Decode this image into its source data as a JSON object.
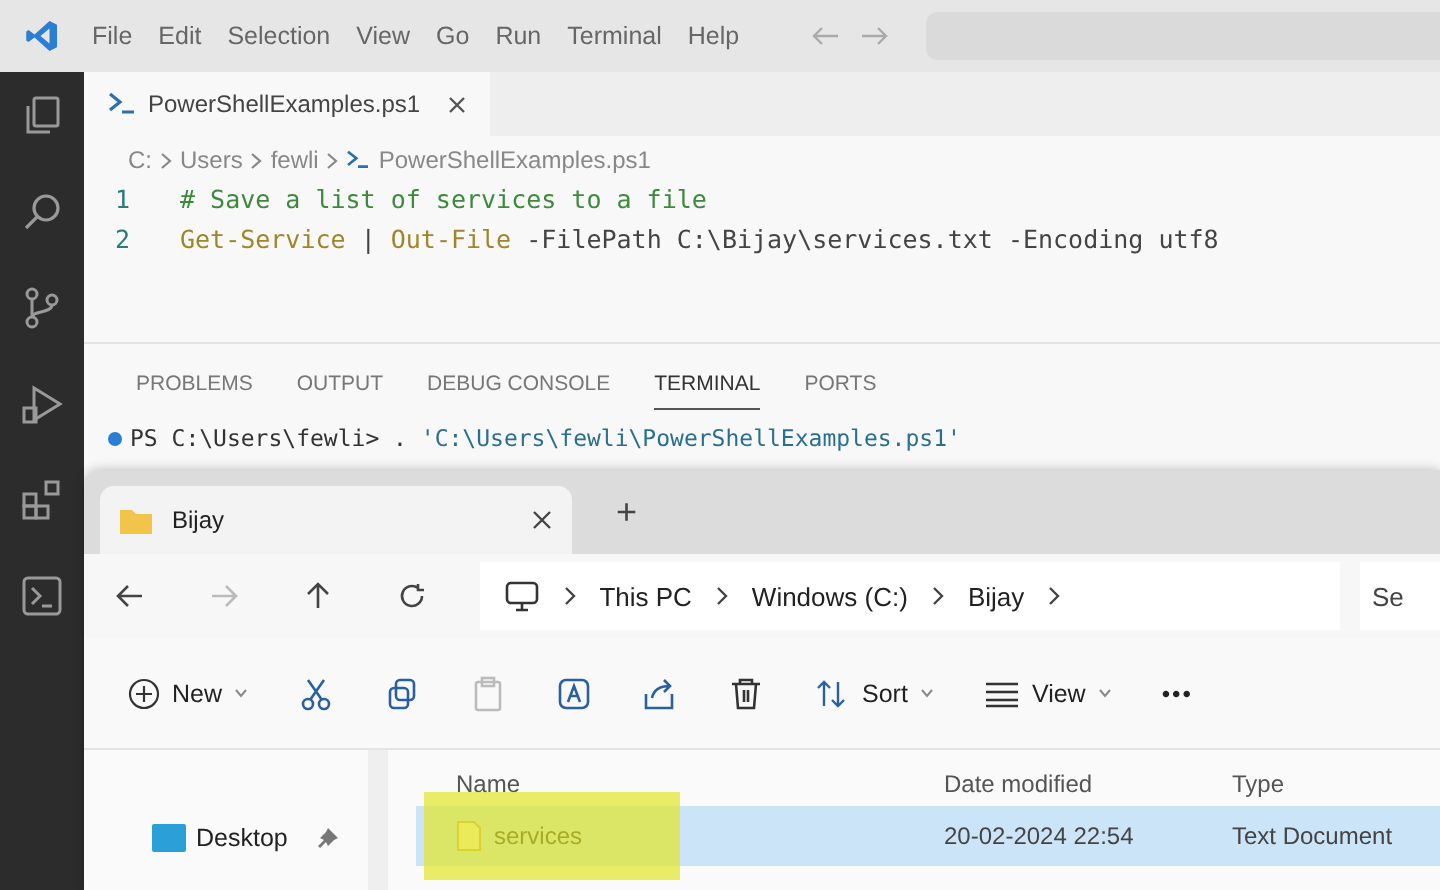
{
  "vscode": {
    "menu": [
      "File",
      "Edit",
      "Selection",
      "View",
      "Go",
      "Run",
      "Terminal",
      "Help"
    ],
    "editor_tab": {
      "title": "PowerShellExamples.ps1",
      "selected": true
    },
    "breadcrumbs": [
      "C:",
      "Users",
      "fewli",
      "PowerShellExamples.ps1"
    ],
    "code_lines": [
      {
        "number": "1",
        "tokens": [
          {
            "kind": "comment",
            "text": "# Save a list of services to a file"
          }
        ]
      },
      {
        "number": "2",
        "tokens": [
          {
            "kind": "command",
            "text": "Get-Service"
          },
          {
            "kind": "plain",
            "text": " | "
          },
          {
            "kind": "command",
            "text": "Out-File"
          },
          {
            "kind": "plain",
            "text": " -FilePath C:\\Bijay\\services.txt -Encoding utf8"
          }
        ]
      }
    ],
    "panel_tabs": [
      {
        "label": "PROBLEMS",
        "selected": false
      },
      {
        "label": "OUTPUT",
        "selected": false
      },
      {
        "label": "DEBUG CONSOLE",
        "selected": false
      },
      {
        "label": "TERMINAL",
        "selected": true
      },
      {
        "label": "PORTS",
        "selected": false
      }
    ],
    "terminal": {
      "prompt": "PS C:\\Users\\fewli> .",
      "path": "'C:\\Users\\fewli\\PowerShellExamples.ps1'"
    }
  },
  "explorer": {
    "tab": {
      "title": "Bijay"
    },
    "new_tab": "+",
    "address": [
      "This PC",
      "Windows (C:)",
      "Bijay"
    ],
    "search": {
      "placeholder": "Se"
    },
    "toolbar": {
      "new": "New",
      "sort": "Sort",
      "view": "View",
      "more": "•••"
    },
    "sidebar": [
      {
        "label": "Desktop",
        "pinned": true
      }
    ],
    "columns": [
      "Name",
      "Date modified",
      "Type"
    ],
    "rows": [
      {
        "name": "services",
        "date": "20-02-2024 22:54",
        "type": "Text Document",
        "selected": true,
        "highlighted": true
      }
    ]
  }
}
